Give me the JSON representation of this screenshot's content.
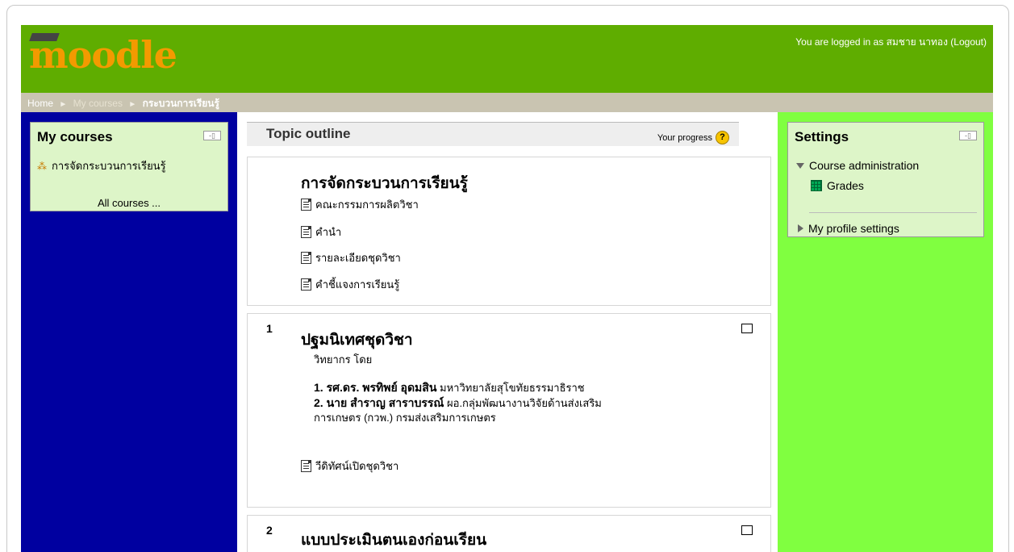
{
  "header": {
    "logo_text": "moodle",
    "login_text": "You are logged in as สมชาย นาทอง (Logout)"
  },
  "breadcrumb": {
    "home": "Home",
    "my_courses": "My courses",
    "current": "กระบวนการเรียนรู้",
    "separator": "►"
  },
  "left_block": {
    "title": "My courses",
    "course_item": "การจัดกระบวนการเรียนรู้",
    "all_courses": "All courses ..."
  },
  "center": {
    "outline_title": "Topic outline",
    "progress_label": "Your progress",
    "help_glyph": "?",
    "section0": {
      "title": "การจัดกระบวนการเรียนรู้",
      "activities": [
        "คณะกรรมการผลิตวิชา",
        "คำนำ",
        "รายละเอียดชุดวิชา",
        "คำชี้แจงการเรียนรู้"
      ]
    },
    "section1": {
      "number": "1",
      "title": "ปฐมนิเทศชุดวิชา",
      "intro": "วิทยากร โดย",
      "line1_bold": "1. รศ.ดร. พรทิพย์ อุดมสิน",
      "line1_rest": " มหาวิทยาลัยสุโขทัยธรรมาธิราช",
      "line2_bold": "2. นาย สำราญ สาราบรรณ์",
      "line2_rest": " ผอ.กลุ่มพัฒนางานวิจัยด้านส่งเสริม",
      "line3": "การเกษตร (กวพ.) กรมส่งเสริมการเกษตร",
      "activity": "วีดิทัศน์เปิดชุดวิชา"
    },
    "section2": {
      "number": "2",
      "title": "แบบประเมินตนเองก่อนเรียน"
    }
  },
  "right_block": {
    "title": "Settings",
    "course_admin": "Course administration",
    "grades": "Grades",
    "profile": "My profile settings"
  },
  "colors": {
    "header_green": "#5fad00",
    "logo_orange": "#f39a00",
    "left_column": "#0000a0",
    "right_column": "#80ff40",
    "block_bg": "#ddf5c8",
    "navbar_bg": "#c9c4b1"
  },
  "icons": {
    "dock": "dock-icon",
    "course": "course-icon",
    "page": "page-icon",
    "grades": "grades-icon",
    "help": "help-icon"
  }
}
